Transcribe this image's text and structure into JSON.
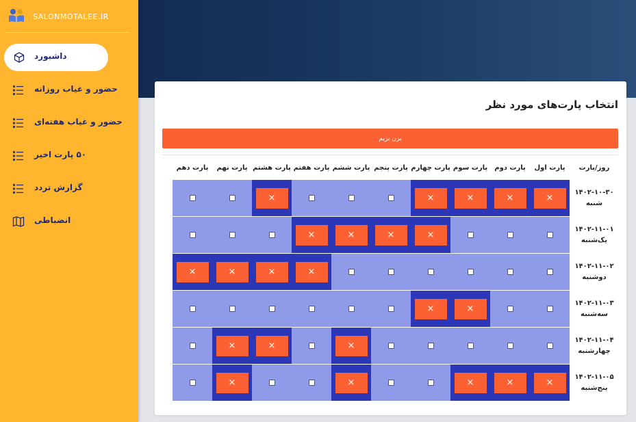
{
  "brand": {
    "text": "SALONMOTALEE.IR",
    "icon": "reading-students-icon"
  },
  "sidebar": {
    "items": [
      {
        "label": "داشبورد",
        "icon": "cube-icon",
        "active": true
      },
      {
        "label": "حضور و غیاب روزانه",
        "icon": "list-icon"
      },
      {
        "label": "حضور و غیاب هفته‌ای",
        "icon": "list-icon"
      },
      {
        "label": "۵۰ پارت اخیر",
        "icon": "list-icon"
      },
      {
        "label": "گزارش تردد",
        "icon": "list-icon"
      },
      {
        "label": "انضباطی",
        "icon": "map-icon"
      }
    ]
  },
  "main": {
    "title": "انتخاب پارت‌های مورد نظر",
    "submit_label": "بزن بریم",
    "table": {
      "corner_header": "روز/پارت",
      "columns": [
        "پارت اول",
        "پارت دوم",
        "پارت سوم",
        "پارت چهارم",
        "پارت پنجم",
        "پارت ششم",
        "پارت هفتم",
        "پارت هشتم",
        "پارت نهم",
        "پارت دهم"
      ],
      "booked_mark": "×",
      "rows": [
        {
          "date": "۱۴۰۲-۱۰-۳۰",
          "day": "شنبه",
          "booked": [
            1,
            1,
            1,
            1,
            0,
            0,
            0,
            1,
            0,
            0
          ]
        },
        {
          "date": "۱۴۰۲-۱۱-۰۱",
          "day": "یک‌شنبه",
          "booked": [
            0,
            0,
            0,
            1,
            1,
            1,
            1,
            0,
            0,
            0
          ]
        },
        {
          "date": "۱۴۰۲-۱۱-۰۲",
          "day": "دوشنبه",
          "booked": [
            0,
            0,
            0,
            0,
            0,
            0,
            1,
            1,
            1,
            1
          ]
        },
        {
          "date": "۱۴۰۲-۱۱-۰۳",
          "day": "سه‌شنبه",
          "booked": [
            0,
            0,
            1,
            1,
            0,
            0,
            0,
            0,
            0,
            0
          ]
        },
        {
          "date": "۱۴۰۲-۱۱-۰۴",
          "day": "چهارشنبه",
          "booked": [
            0,
            0,
            0,
            0,
            0,
            1,
            0,
            1,
            1,
            0
          ]
        },
        {
          "date": "۱۴۰۲-۱۱-۰۵",
          "day": "پنج‌شنبه",
          "booked": [
            1,
            1,
            1,
            0,
            0,
            1,
            0,
            0,
            1,
            0
          ]
        }
      ]
    }
  },
  "colors": {
    "sidebar": "#ffb52e",
    "accent": "#fb6132",
    "slot_free": "#8f9ae8",
    "slot_booked": "#2c37b8",
    "nav_text": "#1e2a78"
  }
}
